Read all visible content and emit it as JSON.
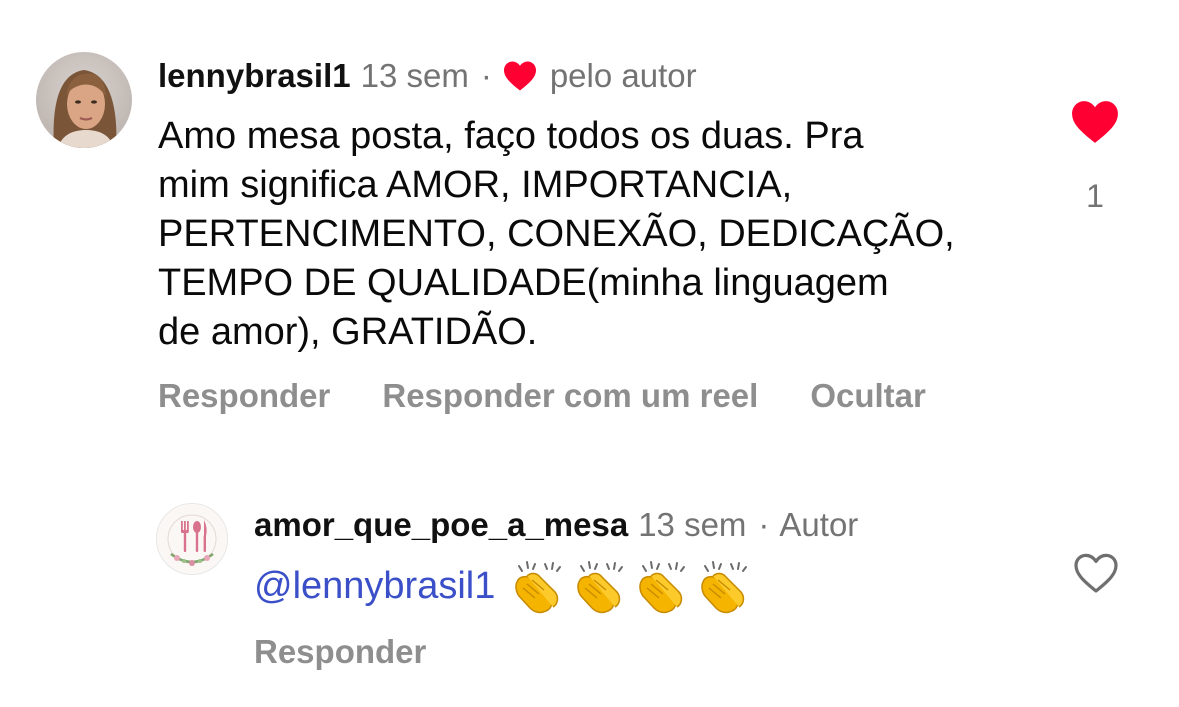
{
  "comment": {
    "username": "lennybrasil1",
    "time": "13 sem",
    "separator": "·",
    "liked_by_author_label": "pelo autor",
    "text": "Amo mesa posta, faço todos os duas. Pra\nmim significa AMOR, IMPORTANCIA,\nPERTENCIMENTO, CONEXÃO, DEDICAÇÃO,\nTEMPO DE QUALIDADE(minha linguagem\nde amor), GRATIDÃO.",
    "like_count": "1",
    "like_icon": "heart-filled-icon",
    "colors": {
      "heart": "#ff0033"
    },
    "actions": {
      "reply": "Responder",
      "reply_reel": "Responder com um reel",
      "hide": "Ocultar"
    }
  },
  "reply": {
    "username": "amor_que_poe_a_mesa",
    "time": "13 sem",
    "separator": "·",
    "badge": "Autor",
    "mention": "@lennybrasil1",
    "emoji": [
      "clap-emoji",
      "clap-emoji",
      "clap-emoji",
      "clap-emoji"
    ],
    "like_icon": "heart-outline-icon",
    "actions": {
      "reply": "Responder"
    }
  }
}
